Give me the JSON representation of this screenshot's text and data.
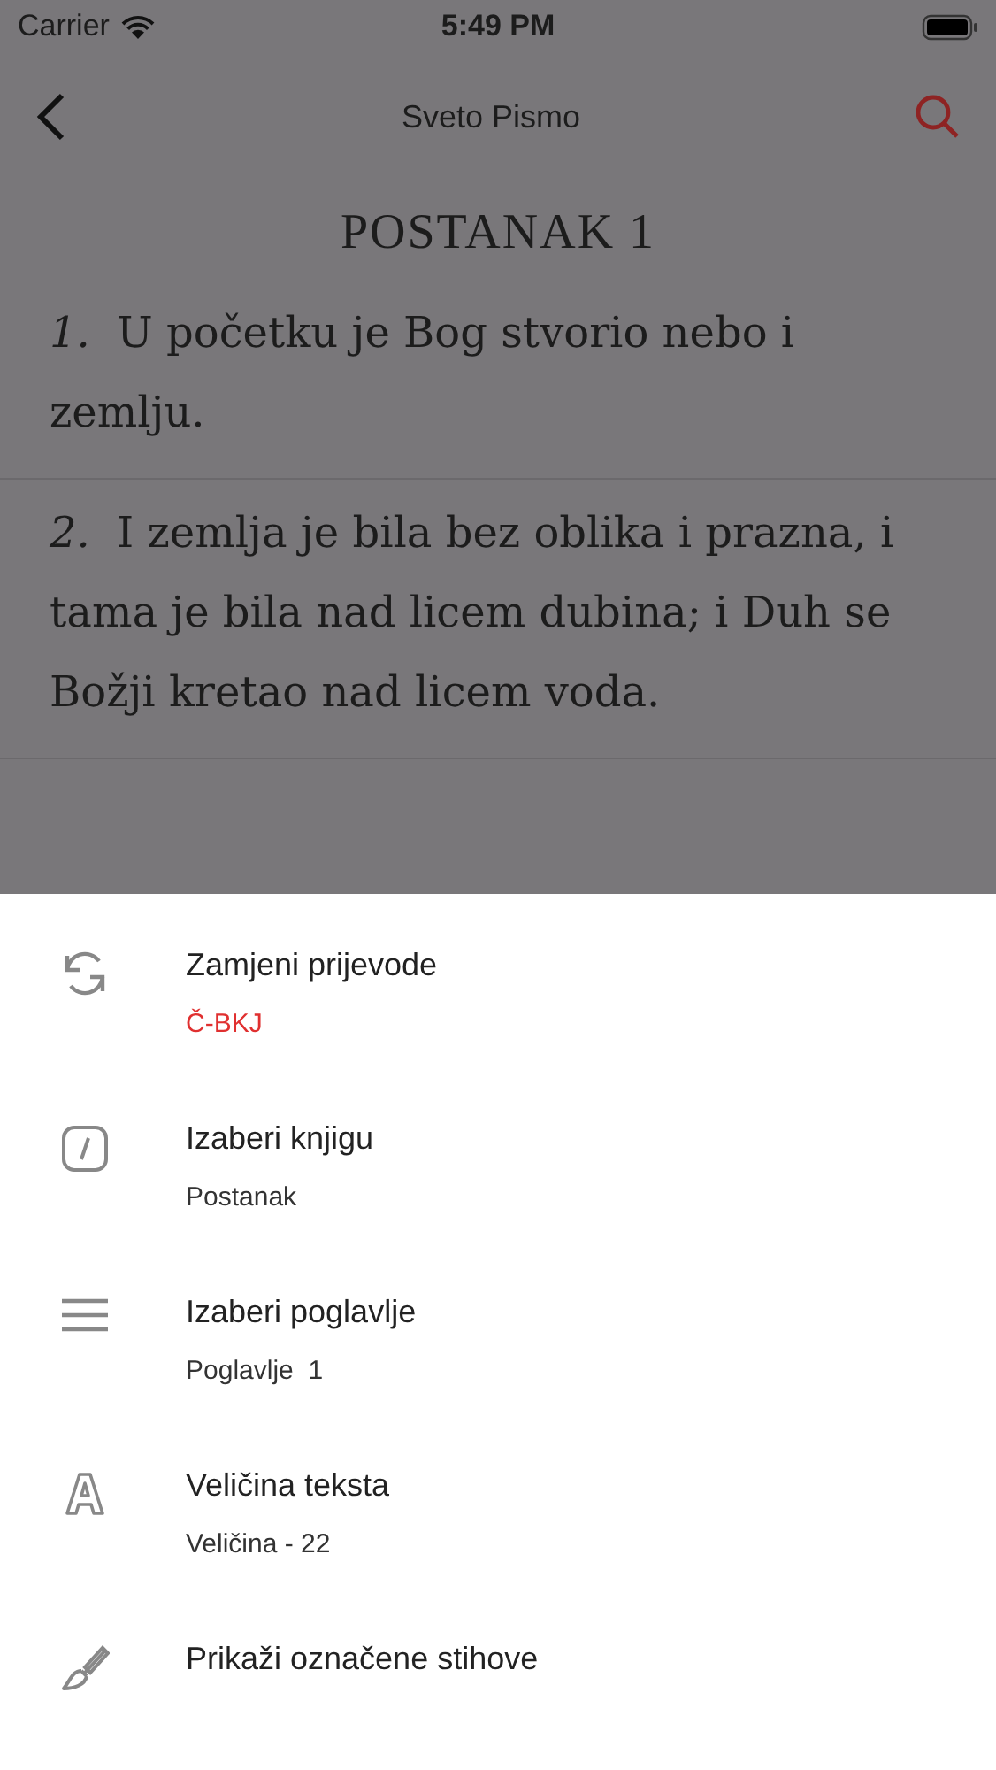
{
  "status_bar": {
    "carrier": "Carrier",
    "time": "5:49 PM"
  },
  "nav": {
    "title": "Sveto Pismo"
  },
  "chapter_title": "POSTANAK 1",
  "verses": [
    {
      "number": "1.",
      "text": "U početku je Bog stvorio nebo i zemlju."
    },
    {
      "number": "2.",
      "text": "I zemlja je bila bez oblika i prazna, i tama je bila nad licem dubina; i Duh se Božji kretao nad licem voda."
    }
  ],
  "menu": [
    {
      "kind": "swap",
      "title": "Zamjeni prijevode",
      "subtitle": "Č-BKJ",
      "accent": true
    },
    {
      "kind": "book",
      "title": "Izaberi knjigu",
      "subtitle": "Postanak",
      "accent": false
    },
    {
      "kind": "list",
      "title": "Izaberi poglavlje",
      "subtitle": "Poglavlje  1",
      "accent": false
    },
    {
      "kind": "text-size",
      "title": "Veličina teksta",
      "subtitle": "Veličina - 22",
      "accent": false
    },
    {
      "kind": "brush",
      "title": "Prikaži označene stihove"
    }
  ]
}
